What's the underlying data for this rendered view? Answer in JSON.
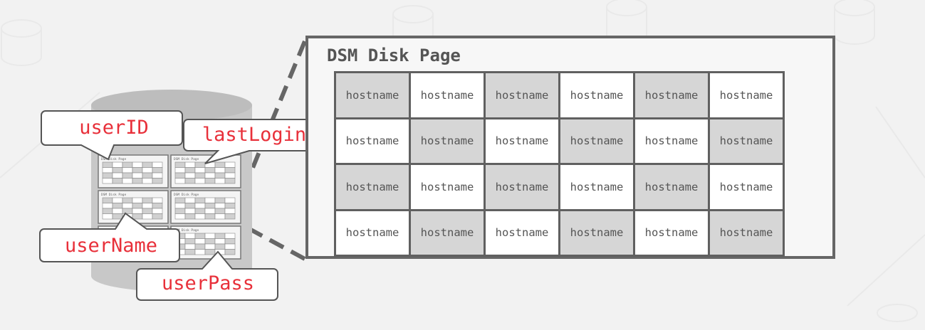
{
  "page": {
    "title": "DSM Disk Page",
    "cells": [
      [
        "hostname",
        "hostname",
        "hostname",
        "hostname",
        "hostname",
        "hostname"
      ],
      [
        "hostname",
        "hostname",
        "hostname",
        "hostname",
        "hostname",
        "hostname"
      ],
      [
        "hostname",
        "hostname",
        "hostname",
        "hostname",
        "hostname",
        "hostname"
      ],
      [
        "hostname",
        "hostname",
        "hostname",
        "hostname",
        "hostname",
        "hostname"
      ]
    ]
  },
  "callouts": {
    "user_id": "userID",
    "last_login": "lastLogin",
    "user_name": "userName",
    "user_pass": "userPass"
  },
  "mini_pages": {
    "label": "DSM Disk Page"
  },
  "colors": {
    "accent_red": "#e8303a",
    "border_gray": "#666666",
    "cell_gray": "#d6d6d6",
    "cell_white": "#ffffff",
    "cylinder": "#c8c8c8"
  }
}
